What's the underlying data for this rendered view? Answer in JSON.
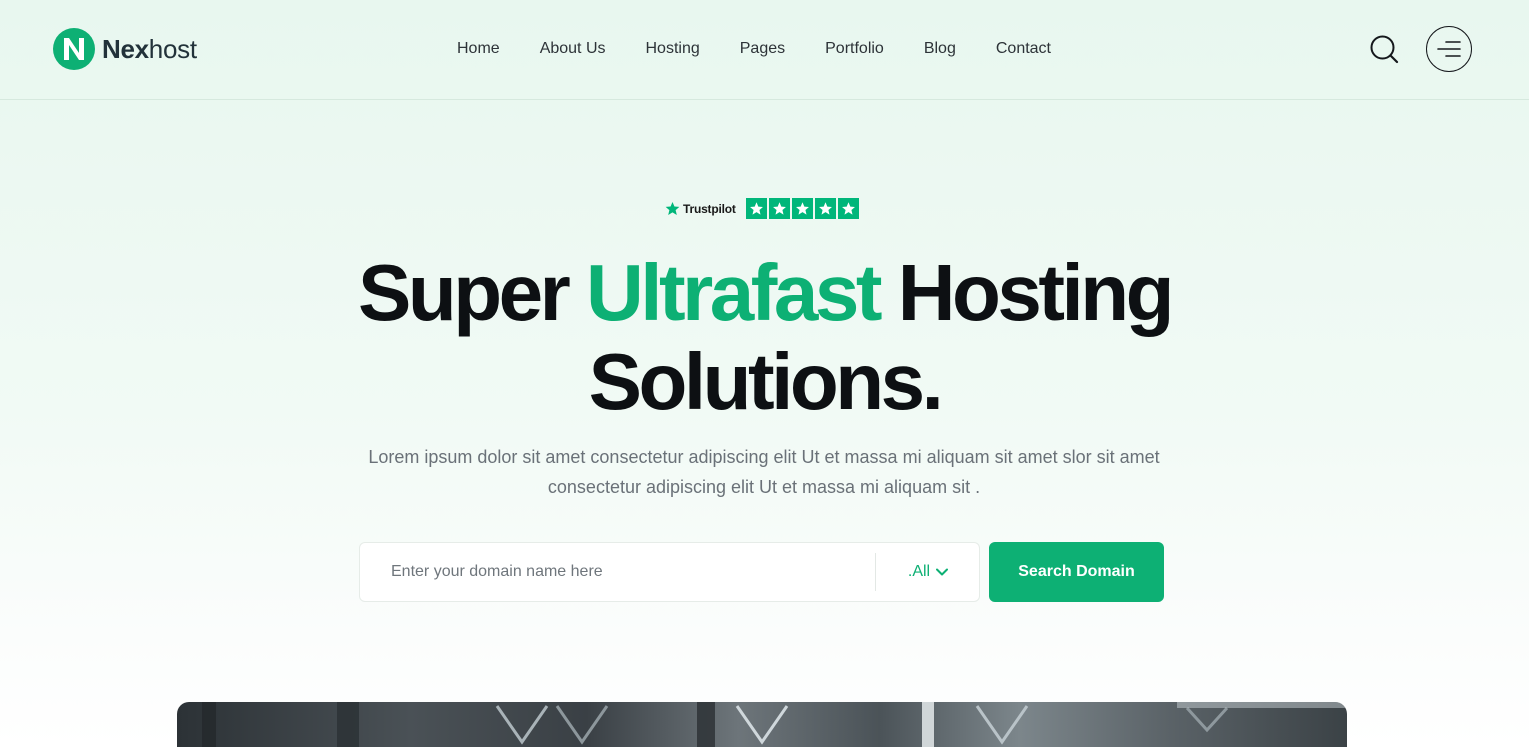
{
  "brand": {
    "name_bold": "Nex",
    "name_light": "host",
    "accent_color": "#0db074",
    "logo_icon": "n-logo-icon"
  },
  "nav": {
    "items": [
      {
        "label": "Home"
      },
      {
        "label": "About Us"
      },
      {
        "label": "Hosting"
      },
      {
        "label": "Pages"
      },
      {
        "label": "Portfolio"
      },
      {
        "label": "Blog"
      },
      {
        "label": "Contact"
      }
    ],
    "search_icon": "search-icon",
    "menu_icon": "hamburger-menu-icon"
  },
  "trustpilot": {
    "label": "Trustpilot",
    "rating": 5,
    "star_color": "#00b67a"
  },
  "hero": {
    "headline_part1": "Super",
    "headline_accent": "Ultrafast",
    "headline_part2": "Hosting",
    "headline_line2": "Solutions.",
    "subtitle": "Lorem ipsum dolor sit amet consectetur adipiscing elit Ut et massa mi aliquam sit amet slor sit amet consectetur adipiscing elit Ut et massa mi aliquam sit ."
  },
  "domain_search": {
    "placeholder": "Enter your domain name here",
    "value": "",
    "tld_selected": ".All",
    "button_label": "Search Domain"
  }
}
